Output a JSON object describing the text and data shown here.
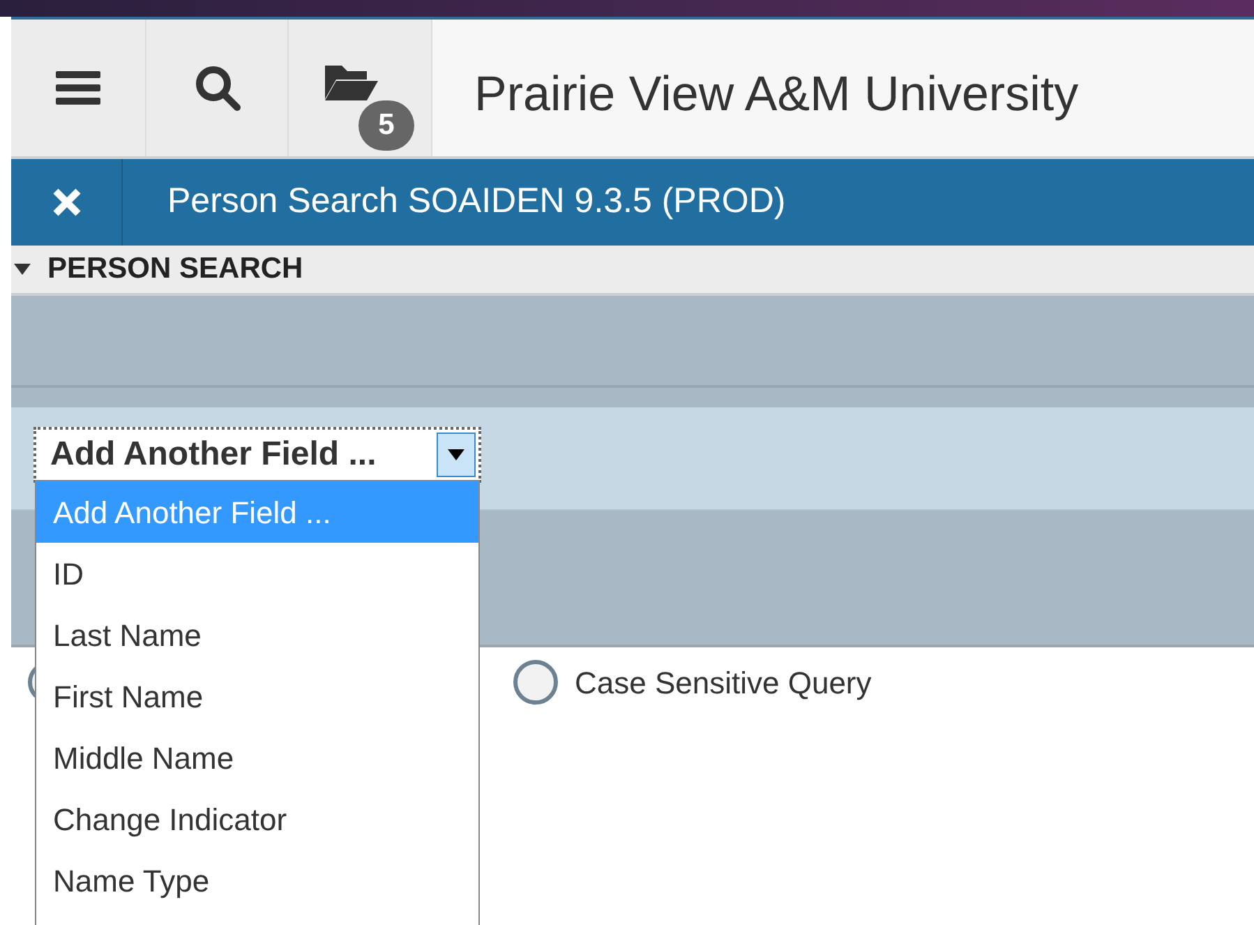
{
  "header": {
    "badge": "5",
    "title": "Prairie View A&M University"
  },
  "page_bar": {
    "title": "Person Search SOAIDEN 9.3.5 (PROD)"
  },
  "section": {
    "title": "PERSON SEARCH",
    "expanded": true
  },
  "add_field": {
    "value": "Add Another Field ...",
    "expanded": true,
    "options": [
      {
        "label": "Add Another Field ...",
        "selected": true
      },
      {
        "label": "ID",
        "selected": false
      },
      {
        "label": "Last Name",
        "selected": false
      },
      {
        "label": "First Name",
        "selected": false
      },
      {
        "label": "Middle Name",
        "selected": false
      },
      {
        "label": "Change Indicator",
        "selected": false
      },
      {
        "label": "Name Type",
        "selected": false
      }
    ]
  },
  "hidden_radio": {
    "checked": false
  },
  "case_sensitive": {
    "label": "Case Sensitive Query",
    "checked": false
  }
}
